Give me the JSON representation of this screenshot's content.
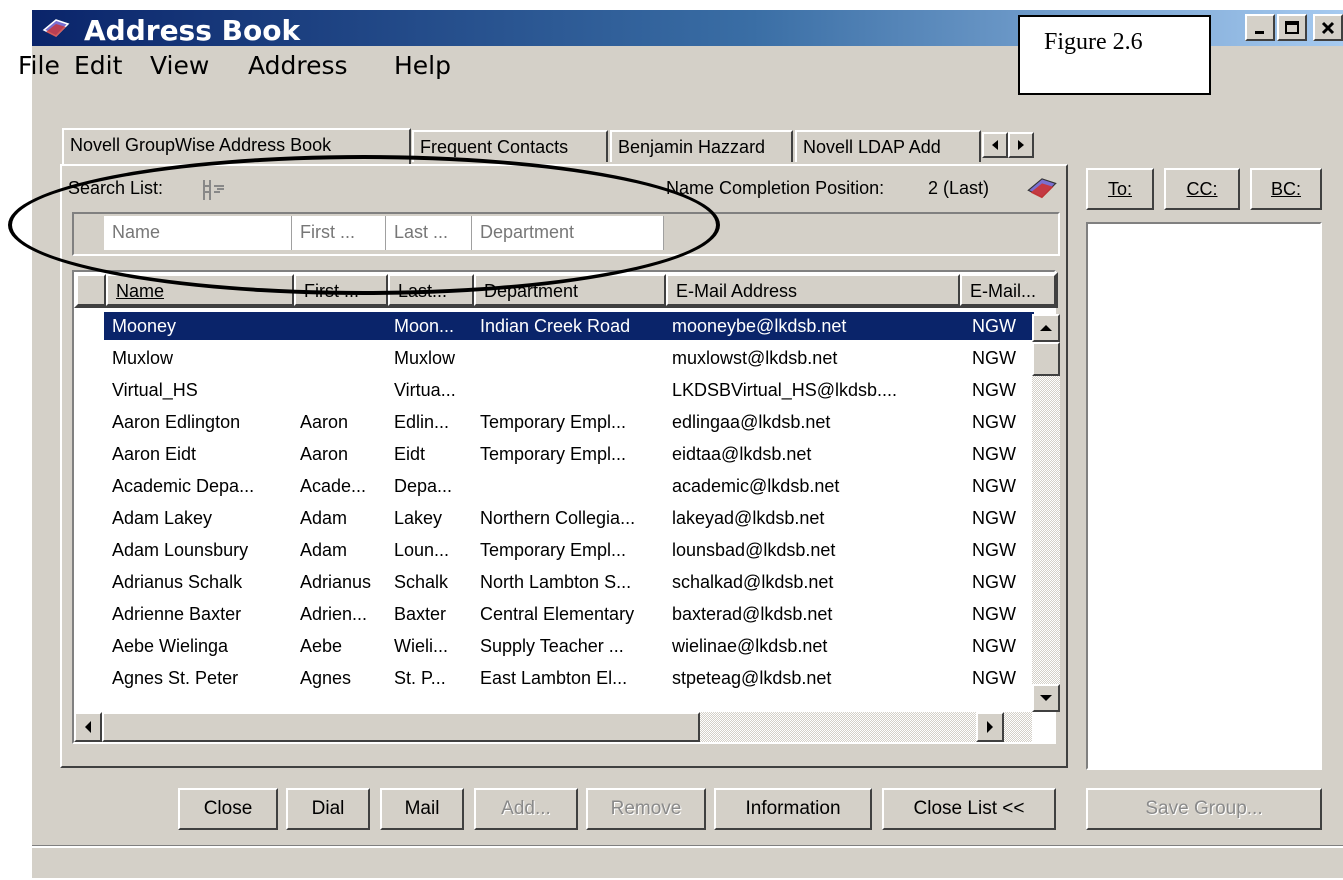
{
  "window": {
    "title": "Address Book"
  },
  "annotation": {
    "figure_label": "Figure 2.6"
  },
  "menu": [
    "File",
    "Edit",
    "View",
    "Address",
    "Help"
  ],
  "tabs": [
    "Novell GroupWise Address Book",
    "Frequent Contacts",
    "Benjamin Hazzard",
    "Novell LDAP Add"
  ],
  "search": {
    "label": "Search List:",
    "completion_label": "Name Completion Position:",
    "completion_value": "2 (Last)",
    "fields": [
      "Name",
      "First ...",
      "Last ...",
      "Department"
    ]
  },
  "table": {
    "headers": [
      "Name",
      "First ...",
      "Last...",
      "Department",
      "E-Mail Address",
      "E-Mail..."
    ],
    "rows": [
      [
        "Mooney",
        "",
        "Moon...",
        "Indian Creek Road",
        "mooneybe@lkdsb.net",
        "NGW"
      ],
      [
        "Muxlow",
        "",
        "Muxlow",
        "",
        "muxlowst@lkdsb.net",
        "NGW"
      ],
      [
        "Virtual_HS",
        "",
        "Virtua...",
        "",
        "LKDSBVirtual_HS@lkdsb....",
        "NGW"
      ],
      [
        "Aaron Edlington",
        "Aaron",
        "Edlin...",
        "Temporary Empl...",
        "edlingaa@lkdsb.net",
        "NGW"
      ],
      [
        "Aaron Eidt",
        "Aaron",
        "Eidt",
        "Temporary Empl...",
        "eidtaa@lkdsb.net",
        "NGW"
      ],
      [
        "Academic Depa...",
        "Acade...",
        "Depa...",
        "",
        "academic@lkdsb.net",
        "NGW"
      ],
      [
        "Adam Lakey",
        "Adam",
        "Lakey",
        "Northern Collegia...",
        "lakeyad@lkdsb.net",
        "NGW"
      ],
      [
        "Adam Lounsbury",
        "Adam",
        "Loun...",
        "Temporary Empl...",
        "lounsbad@lkdsb.net",
        "NGW"
      ],
      [
        "Adrianus Schalk",
        "Adrianus",
        "Schalk",
        "North Lambton S...",
        "schalkad@lkdsb.net",
        "NGW"
      ],
      [
        "Adrienne Baxter",
        "Adrien...",
        "Baxter",
        "Central Elementary",
        "baxterad@lkdsb.net",
        "NGW"
      ],
      [
        "Aebe Wielinga",
        "Aebe",
        "Wieli...",
        "Supply Teacher ...",
        "wielinae@lkdsb.net",
        "NGW"
      ],
      [
        "Agnes St. Peter",
        "Agnes",
        "St. P...",
        "East Lambton El...",
        "stpeteag@lkdsb.net",
        "NGW"
      ]
    ]
  },
  "recipients": {
    "to": "To:",
    "cc": "CC:",
    "bc": "BC:"
  },
  "buttons": {
    "close": "Close",
    "dial": "Dial",
    "mail": "Mail",
    "add": "Add...",
    "remove": "Remove",
    "information": "Information",
    "close_list": "Close List <<",
    "save_group": "Save Group..."
  }
}
